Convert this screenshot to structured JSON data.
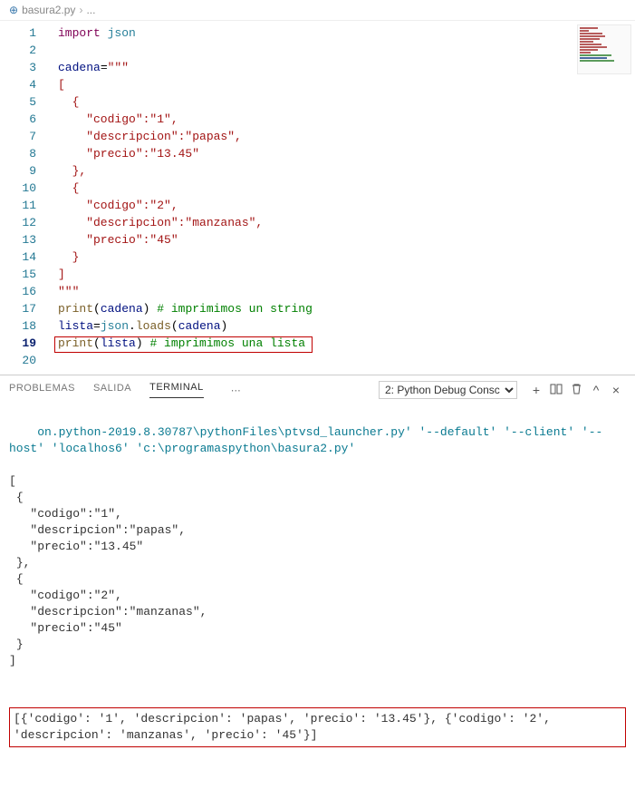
{
  "breadcrumb": {
    "file": "basura2.py",
    "tail": "..."
  },
  "editor": {
    "active_line": 19,
    "lines": [
      {
        "n": 1,
        "tokens": [
          [
            "kw-import",
            "import"
          ],
          [
            "",
            ""
          ],
          [
            "kw-op",
            " "
          ],
          [
            "kw-mod",
            "json"
          ]
        ]
      },
      {
        "n": 2,
        "tokens": []
      },
      {
        "n": 3,
        "tokens": [
          [
            "kw-var",
            "cadena"
          ],
          [
            "kw-op",
            "="
          ],
          [
            "kw-str",
            "\"\"\""
          ]
        ]
      },
      {
        "n": 4,
        "tokens": [
          [
            "kw-str",
            "["
          ]
        ]
      },
      {
        "n": 5,
        "tokens": [
          [
            "kw-str",
            "  {"
          ]
        ]
      },
      {
        "n": 6,
        "tokens": [
          [
            "kw-str",
            "    \"codigo\":\"1\","
          ]
        ]
      },
      {
        "n": 7,
        "tokens": [
          [
            "kw-str",
            "    \"descripcion\":\"papas\","
          ]
        ]
      },
      {
        "n": 8,
        "tokens": [
          [
            "kw-str",
            "    \"precio\":\"13.45\""
          ]
        ]
      },
      {
        "n": 9,
        "tokens": [
          [
            "kw-str",
            "  },"
          ]
        ]
      },
      {
        "n": 10,
        "tokens": [
          [
            "kw-str",
            "  {"
          ]
        ]
      },
      {
        "n": 11,
        "tokens": [
          [
            "kw-str",
            "    \"codigo\":\"2\","
          ]
        ]
      },
      {
        "n": 12,
        "tokens": [
          [
            "kw-str",
            "    \"descripcion\":\"manzanas\","
          ]
        ]
      },
      {
        "n": 13,
        "tokens": [
          [
            "kw-str",
            "    \"precio\":\"45\""
          ]
        ]
      },
      {
        "n": 14,
        "tokens": [
          [
            "kw-str",
            "  }"
          ]
        ]
      },
      {
        "n": 15,
        "tokens": [
          [
            "kw-str",
            "]"
          ]
        ]
      },
      {
        "n": 16,
        "tokens": [
          [
            "kw-str",
            "\"\"\""
          ]
        ]
      },
      {
        "n": 17,
        "tokens": [
          [
            "kw-fn",
            "print"
          ],
          [
            "kw-op",
            "("
          ],
          [
            "kw-var",
            "cadena"
          ],
          [
            "kw-op",
            ") "
          ],
          [
            "kw-cmt",
            "# imprimimos un string"
          ]
        ]
      },
      {
        "n": 18,
        "tokens": [
          [
            "kw-var",
            "lista"
          ],
          [
            "kw-op",
            "="
          ],
          [
            "kw-mod",
            "json"
          ],
          [
            "kw-op",
            "."
          ],
          [
            "kw-fn",
            "loads"
          ],
          [
            "kw-op",
            "("
          ],
          [
            "kw-var",
            "cadena"
          ],
          [
            "kw-op",
            ")"
          ]
        ]
      },
      {
        "n": 19,
        "tokens": [
          [
            "kw-fn",
            "print"
          ],
          [
            "kw-op",
            "("
          ],
          [
            "kw-var",
            "lista"
          ],
          [
            "kw-op",
            ") "
          ],
          [
            "kw-cmt",
            "# imprimimos una lista"
          ]
        ]
      },
      {
        "n": 20,
        "tokens": []
      }
    ]
  },
  "panel": {
    "tabs": [
      "PROBLEMAS",
      "SALIDA",
      "TERMINAL"
    ],
    "active_tab": "TERMINAL",
    "dropdown": "2: Python Debug Consc",
    "icons": {
      "add": "+",
      "split": "⫿⫿",
      "trash": "🗑",
      "up": "^",
      "close": "×"
    }
  },
  "terminal": {
    "cmd_line": "on.python-2019.8.30787\\pythonFiles\\ptvsd_launcher.py' '--default' '--client' '--host' 'localhos6' 'c:\\programaspython\\basura2.py'",
    "body": "\n[\n {\n   \"codigo\":\"1\",\n   \"descripcion\":\"papas\",\n   \"precio\":\"13.45\"\n },\n {\n   \"codigo\":\"2\",\n   \"descripcion\":\"manzanas\",\n   \"precio\":\"45\"\n }\n]\n",
    "highlighted": "[{'codigo': '1', 'descripcion': 'papas', 'precio': '13.45'}, {'codigo': '2', 'descripcion': 'manzanas', 'precio': '45'}]"
  }
}
